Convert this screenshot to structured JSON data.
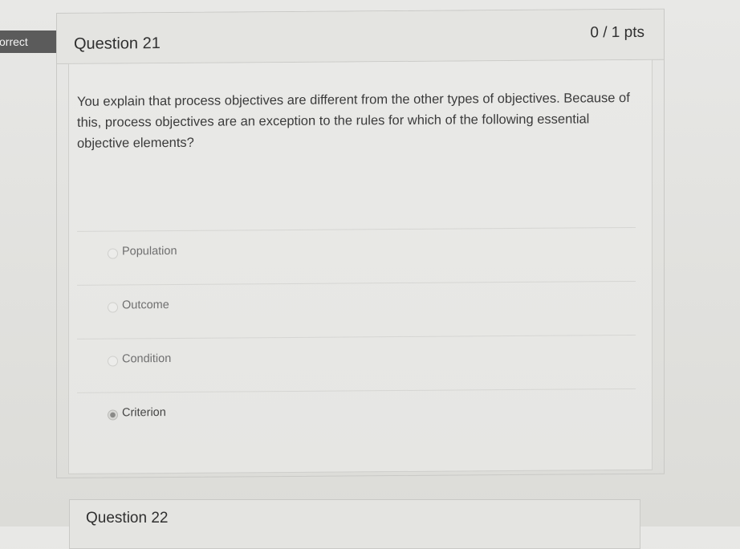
{
  "banner": {
    "label": "correct"
  },
  "question": {
    "title": "Question 21",
    "points": "0 / 1 pts",
    "text": "You explain that process objectives are different from the other types of objectives. Because of this, process objectives are an exception to the rules for which of the following essential objective elements?",
    "answers": [
      {
        "label": "Population",
        "selected": false
      },
      {
        "label": "Outcome",
        "selected": false
      },
      {
        "label": "Condition",
        "selected": false
      },
      {
        "label": "Criterion",
        "selected": true
      }
    ]
  },
  "next_question": {
    "title": "Question 22"
  },
  "colors": {
    "banner_bg": "#5b5b5b",
    "page_bg": "#e4e4e1",
    "text": "#3b3b3b"
  }
}
